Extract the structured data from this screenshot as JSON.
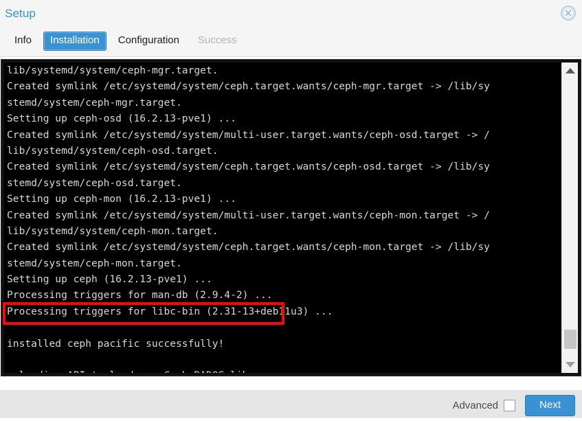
{
  "window": {
    "title": "Setup",
    "close_icon": "close-circle-icon"
  },
  "tabs": [
    {
      "label": "Info",
      "state": "enabled"
    },
    {
      "label": "Installation",
      "state": "active"
    },
    {
      "label": "Configuration",
      "state": "enabled"
    },
    {
      "label": "Success",
      "state": "disabled"
    }
  ],
  "terminal": {
    "lines": [
      "lib/systemd/system/ceph-mgr.target.",
      "Created symlink /etc/systemd/system/ceph.target.wants/ceph-mgr.target -> /lib/sy",
      "stemd/system/ceph-mgr.target.",
      "Setting up ceph-osd (16.2.13-pve1) ...",
      "Created symlink /etc/systemd/system/multi-user.target.wants/ceph-osd.target -> /",
      "lib/systemd/system/ceph-osd.target.",
      "Created symlink /etc/systemd/system/ceph.target.wants/ceph-osd.target -> /lib/sy",
      "stemd/system/ceph-osd.target.",
      "Setting up ceph-mon (16.2.13-pve1) ...",
      "Created symlink /etc/systemd/system/multi-user.target.wants/ceph-mon.target -> /",
      "lib/systemd/system/ceph-mon.target.",
      "Created symlink /etc/systemd/system/ceph.target.wants/ceph-mon.target -> /lib/sy",
      "stemd/system/ceph-mon.target.",
      "Setting up ceph (16.2.13-pve1) ...",
      "Processing triggers for man-db (2.9.4-2) ...",
      "Processing triggers for libc-bin (2.31-13+deb11u3) ...",
      "",
      "installed ceph pacific successfully!",
      "",
      "reloading API to load new Ceph RADOS library..."
    ],
    "cursor": "text-cursor-block"
  },
  "annotation": {
    "name": "highlight-rectangle",
    "color": "#f90606",
    "target_text": "installed ceph pacific successfully!"
  },
  "scrollbar": {
    "up_arrow": "scroll-up-arrow-icon",
    "down_arrow": "scroll-down-arrow-icon",
    "thumb": "scrollbar-thumb"
  },
  "footer": {
    "advanced_label": "Advanced",
    "advanced_checked": false,
    "next_label": "Next"
  },
  "colors": {
    "accent": "#3892d4",
    "title": "#3892d4",
    "terminal_bg": "#000000",
    "terminal_fg": "#d8d8d8",
    "annotation": "#f90606",
    "chrome_bg": "#f5f5f5",
    "footer_bg": "#e6e6e6"
  }
}
